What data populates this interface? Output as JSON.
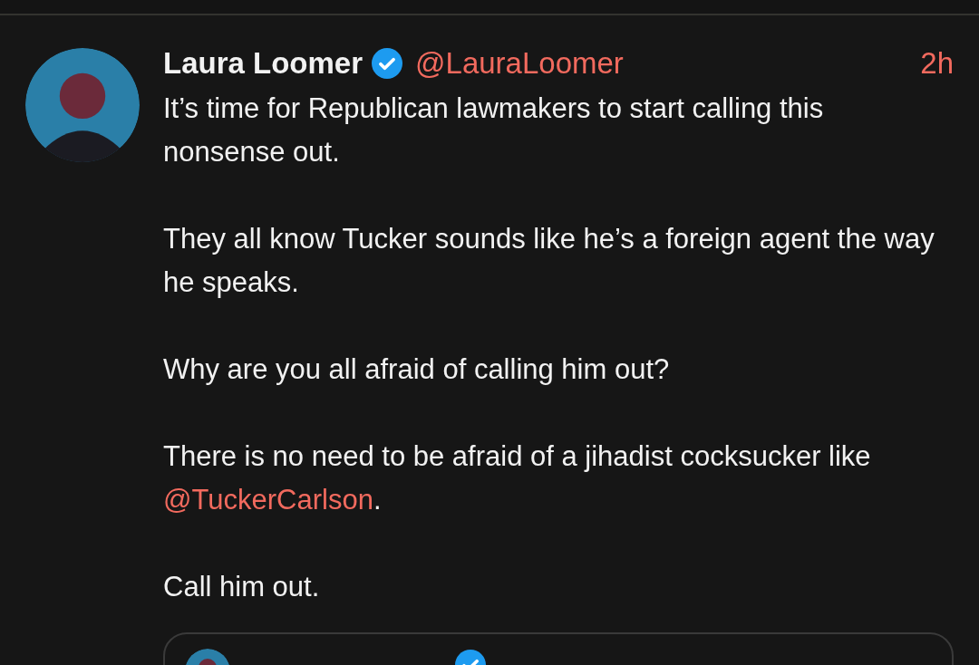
{
  "post": {
    "author": {
      "name": "Laura Loomer",
      "verified": true,
      "handle": "@LauraLoomer"
    },
    "time": "2h",
    "paragraphs": [
      [
        {
          "kind": "text",
          "text": "It’s time for Republican lawmakers to start calling this nonsense out."
        }
      ],
      [
        {
          "kind": "text",
          "text": "They all know Tucker sounds like he’s a foreign agent the way he speaks."
        }
      ],
      [
        {
          "kind": "text",
          "text": "Why are you all afraid of calling him out?"
        }
      ],
      [
        {
          "kind": "text",
          "text": "There is no need to be afraid of a jihadist cocksucker like "
        },
        {
          "kind": "mention",
          "text": "@TuckerCarlson"
        },
        {
          "kind": "text",
          "text": "."
        }
      ],
      [
        {
          "kind": "text",
          "text": "Call him out."
        }
      ]
    ],
    "quoted_post": {
      "verified": true
    }
  }
}
